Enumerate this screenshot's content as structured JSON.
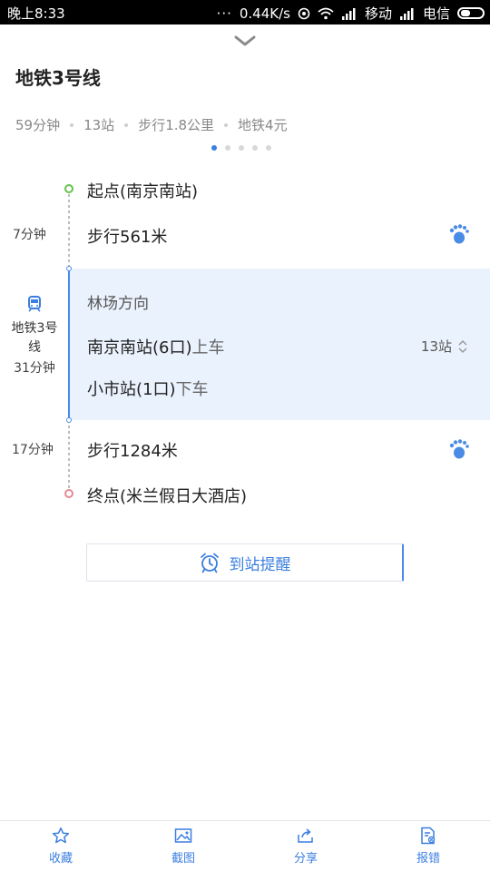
{
  "status_bar": {
    "time": "晚上8:33",
    "dots": "···",
    "speed": "0.44K/s",
    "carrier1": "移动",
    "carrier2": "电信"
  },
  "route": {
    "title": "地铁3号线",
    "summary": [
      "59分钟",
      "13站",
      "步行1.8公里",
      "地铁4元"
    ],
    "pager": {
      "count": 5,
      "active": 0
    }
  },
  "steps": {
    "start": "起点(南京南站)",
    "walk1": {
      "duration": "7分钟",
      "text": "步行561米"
    },
    "subway": {
      "line_name": "地铁3号线",
      "duration": "31分钟",
      "direction": "林场方向",
      "board_station": "南京南站(6口)",
      "board_action": "上车",
      "alight_station": "小市站(1口)",
      "alight_action": "下车",
      "stops": "13站"
    },
    "walk2": {
      "duration": "17分钟",
      "text": "步行1284米"
    },
    "end": "终点(米兰假日大酒店)"
  },
  "alarm_button": {
    "label": "到站提醒"
  },
  "bottom_tabs": [
    {
      "label": "收藏",
      "icon": "star-icon"
    },
    {
      "label": "截图",
      "icon": "image-icon"
    },
    {
      "label": "分享",
      "icon": "share-icon"
    },
    {
      "label": "报错",
      "icon": "report-icon"
    }
  ],
  "colors": {
    "accent": "#3b7fe0",
    "start": "#63c34b",
    "end": "#e58a94",
    "subway_bg": "#eaf2fd"
  }
}
